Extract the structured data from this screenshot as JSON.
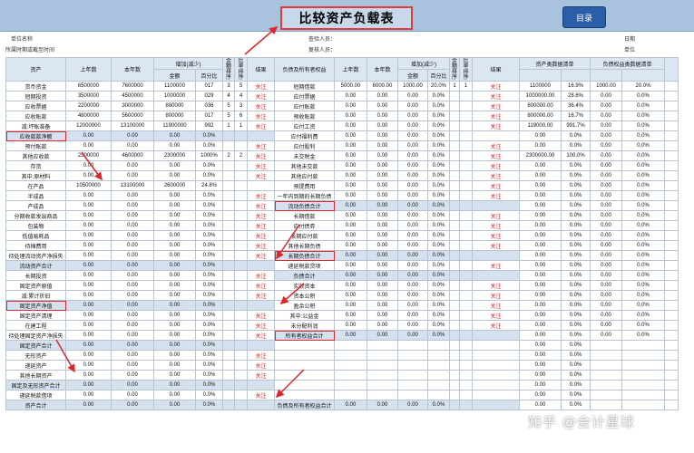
{
  "header": {
    "title": "比较资产负载表",
    "menu_button": "目录"
  },
  "meta": {
    "unit_name": "单位名称",
    "period": "所属时期或截至时间",
    "audit_person": "查验人员：",
    "review_person": "复核人员：",
    "date": "日期",
    "unit": "单位"
  },
  "table": {
    "head_top": {
      "asset": "资产",
      "y_start": "上年数",
      "y_cur": "本年数",
      "change": "增加(减少)",
      "amt_rank": "金额排序",
      "ratio_rank": "比率排序",
      "result": "结果",
      "liab": "负债及所有者权益",
      "l_start": "上年数",
      "l_cur": "本年数",
      "l_change": "增加(减少)",
      "l_amt_rank": "金额排序",
      "l_ratio_rank": "比率排序",
      "l_result": "结果",
      "asset_list": "资产类数据清单",
      "liab_list": "负债权益类数据清单"
    },
    "head_sub": {
      "amount": "金额",
      "pct": "百分比",
      "amount2": "金额",
      "pct2": "百分比"
    },
    "rows": [
      {
        "a": "货币资金",
        "y0": "6500000",
        "y1": "7600000",
        "d": "1100000",
        "p": "017",
        "r1": "3",
        "r2": "5",
        "res": "关注",
        "l": "短期借款",
        "l0": "5000.00",
        "l1": "6000.00",
        "ld": "1000.00",
        "lp": "20.0%",
        "lr1": "1",
        "lr2": "1",
        "lres": "关注",
        "sa": "1100000",
        "sp": "16.9%",
        "sb": "1000.00",
        "sq": "20.0%"
      },
      {
        "a": "短期投资",
        "y0": "3500000",
        "y1": "4500000",
        "d": "1000000",
        "p": "029",
        "r1": "4",
        "r2": "4",
        "res": "关注",
        "l": "应付票据",
        "l0": "0.00",
        "l1": "0.00",
        "ld": "0.00",
        "lp": "0.0%",
        "lr1": "",
        "lr2": "",
        "lres": "关注",
        "sa": "1000000.00",
        "sp": "28.6%",
        "sb": "0.00",
        "sq": "0.0%"
      },
      {
        "a": "应收票据",
        "y0": "2200000",
        "y1": "3000000",
        "d": "800000",
        "p": "036",
        "r1": "5",
        "r2": "3",
        "res": "关注",
        "l": "应付账款",
        "l0": "0.00",
        "l1": "0.00",
        "ld": "0.00",
        "lp": "0.0%",
        "lr1": "",
        "lr2": "",
        "lres": "关注",
        "sa": "800000.00",
        "sp": "36.4%",
        "sb": "0.00",
        "sq": "0.0%"
      },
      {
        "a": "应收账款",
        "y0": "4800000",
        "y1": "5600000",
        "d": "800000",
        "p": "017",
        "r1": "5",
        "r2": "6",
        "res": "关注",
        "l": "预收账款",
        "l0": "0.00",
        "l1": "0.00",
        "ld": "0.00",
        "lp": "0.0%",
        "lr1": "",
        "lr2": "",
        "lres": "关注",
        "sa": "800000.00",
        "sp": "16.7%",
        "sb": "0.00",
        "sq": "0.0%"
      },
      {
        "a": "减:坏账准备",
        "y0": "12000000",
        "y1": "13100000",
        "d": "11900000",
        "p": "992",
        "r1": "1",
        "r2": "1",
        "res": "关注",
        "l": "应付工资",
        "l0": "0.00",
        "l1": "0.00",
        "ld": "0.00",
        "lp": "0.0%",
        "lr1": "",
        "lr2": "",
        "lres": "关注",
        "sa": "119000.00",
        "sp": "991.7%",
        "sb": "0.00",
        "sq": "0.0%"
      },
      {
        "a": "应收款款净额",
        "y0": "0.00",
        "y1": "0.00",
        "d": "0.00",
        "p": "0.0%",
        "r1": "",
        "r2": "",
        "res": "",
        "l": "应付福利费",
        "l0": "0.00",
        "l1": "0.00",
        "ld": "0.00",
        "lp": "0.0%",
        "lr1": "",
        "lr2": "",
        "lres": "",
        "sa": "0.00",
        "sp": "0.0%",
        "sb": "0.00",
        "sq": "0.0%",
        "hl": true,
        "box": true
      },
      {
        "a": "预付账款",
        "y0": "0.00",
        "y1": "0.00",
        "d": "0.00",
        "p": "0.0%",
        "r1": "",
        "r2": "",
        "res": "关注",
        "l": "应付股利",
        "l0": "0.00",
        "l1": "0.00",
        "ld": "0.00",
        "lp": "0.0%",
        "lr1": "",
        "lr2": "",
        "lres": "关注",
        "sa": "0.00",
        "sp": "0.0%",
        "sb": "0.00",
        "sq": "0.0%"
      },
      {
        "a": "其他应收款",
        "y0": "2300000",
        "y1": "4600000",
        "d": "2300000",
        "p": "1000%",
        "r1": "2",
        "r2": "2",
        "res": "关注",
        "l": "未交税金",
        "l0": "0.00",
        "l1": "0.00",
        "ld": "0.00",
        "lp": "0.0%",
        "lr1": "",
        "lr2": "",
        "lres": "关注",
        "sa": "2300000.00",
        "sp": "100.0%",
        "sb": "0.00",
        "sq": "0.0%"
      },
      {
        "a": "存货",
        "y0": "0.00",
        "y1": "0.00",
        "d": "0.00",
        "p": "0.0%",
        "r1": "",
        "r2": "",
        "res": "关注",
        "l": "其他未交款",
        "l0": "0.00",
        "l1": "0.00",
        "ld": "0.00",
        "lp": "0.0%",
        "lr1": "",
        "lr2": "",
        "lres": "关注",
        "sa": "0.00",
        "sp": "0.0%",
        "sb": "0.00",
        "sq": "0.0%"
      },
      {
        "a": "其中:原材料",
        "y0": "0.00",
        "y1": "0.00",
        "d": "0.00",
        "p": "0.0%",
        "r1": "",
        "r2": "",
        "res": "关注",
        "l": "其他应付款",
        "l0": "0.00",
        "l1": "0.00",
        "ld": "0.00",
        "lp": "0.0%",
        "lr1": "",
        "lr2": "",
        "lres": "关注",
        "sa": "0.00",
        "sp": "0.0%",
        "sb": "0.00",
        "sq": "0.0%"
      },
      {
        "a": "在产品",
        "y0": "10500000",
        "y1": "13100000",
        "d": "2600000",
        "p": "24.8%",
        "r1": "",
        "r2": "",
        "res": "",
        "l": "预提费用",
        "l0": "0.00",
        "l1": "0.00",
        "ld": "0.00",
        "lp": "0.0%",
        "lr1": "",
        "lr2": "",
        "lres": "关注",
        "sa": "0.00",
        "sp": "0.0%",
        "sb": "0.00",
        "sq": "0.0%"
      },
      {
        "a": "半成品",
        "y0": "0.00",
        "y1": "0.00",
        "d": "0.00",
        "p": "0.0%",
        "r1": "",
        "r2": "",
        "res": "关注",
        "l": "一年内到期的长期负债",
        "l0": "0.00",
        "l1": "0.00",
        "ld": "0.00",
        "lp": "0.0%",
        "lr1": "",
        "lr2": "",
        "lres": "关注",
        "sa": "0.00",
        "sp": "0.0%",
        "sb": "0.00",
        "sq": "0.0%"
      },
      {
        "a": "产成品",
        "y0": "0.00",
        "y1": "0.00",
        "d": "0.00",
        "p": "0.0%",
        "r1": "",
        "r2": "",
        "res": "关注",
        "l": "流动负债合计",
        "l0": "0.00",
        "l1": "0.00",
        "ld": "0.00",
        "lp": "0.0%",
        "lr1": "",
        "lr2": "",
        "lres": "",
        "sa": "0.00",
        "sp": "0.0%",
        "sb": "0.00",
        "sq": "0.0%",
        "lhl": true,
        "lbox": true
      },
      {
        "a": "分期收款发出商品",
        "y0": "0.00",
        "y1": "0.00",
        "d": "0.00",
        "p": "0.0%",
        "r1": "",
        "r2": "",
        "res": "关注",
        "l": "长期借款",
        "l0": "0.00",
        "l1": "0.00",
        "ld": "0.00",
        "lp": "0.0%",
        "lr1": "",
        "lr2": "",
        "lres": "关注",
        "sa": "0.00",
        "sp": "0.0%",
        "sb": "0.00",
        "sq": "0.0%"
      },
      {
        "a": "包装物",
        "y0": "0.00",
        "y1": "0.00",
        "d": "0.00",
        "p": "0.0%",
        "r1": "",
        "r2": "",
        "res": "关注",
        "l": "应付债券",
        "l0": "0.00",
        "l1": "0.00",
        "ld": "0.00",
        "lp": "0.0%",
        "lr1": "",
        "lr2": "",
        "lres": "关注",
        "sa": "0.00",
        "sp": "0.0%",
        "sb": "0.00",
        "sq": "0.0%"
      },
      {
        "a": "低值易耗品",
        "y0": "0.00",
        "y1": "0.00",
        "d": "0.00",
        "p": "0.0%",
        "r1": "",
        "r2": "",
        "res": "关注",
        "l": "长期应付款",
        "l0": "0.00",
        "l1": "0.00",
        "ld": "0.00",
        "lp": "0.0%",
        "lr1": "",
        "lr2": "",
        "lres": "关注",
        "sa": "0.00",
        "sp": "0.0%",
        "sb": "0.00",
        "sq": "0.0%"
      },
      {
        "a": "待摊费用",
        "y0": "0.00",
        "y1": "0.00",
        "d": "0.00",
        "p": "0.0%",
        "r1": "",
        "r2": "",
        "res": "关注",
        "l": "其他长期负债",
        "l0": "0.00",
        "l1": "0.00",
        "ld": "0.00",
        "lp": "0.0%",
        "lr1": "",
        "lr2": "",
        "lres": "关注",
        "sa": "0.00",
        "sp": "0.0%",
        "sb": "0.00",
        "sq": "0.0%"
      },
      {
        "a": "待处理流动资产净损失",
        "y0": "0.00",
        "y1": "0.00",
        "d": "0.00",
        "p": "0.0%",
        "r1": "",
        "r2": "",
        "res": "关注",
        "l": "长期负债合计",
        "l0": "0.00",
        "l1": "0.00",
        "ld": "0.00",
        "lp": "0.0%",
        "lr1": "",
        "lr2": "",
        "lres": "",
        "sa": "0.00",
        "sp": "0.0%",
        "sb": "0.00",
        "sq": "0.0%",
        "lhl": true,
        "lbox": true
      },
      {
        "a": "流动资产合计",
        "y0": "0.00",
        "y1": "0.00",
        "d": "0.00",
        "p": "0.0%",
        "r1": "",
        "r2": "",
        "res": "",
        "l": "递延税款贷项",
        "l0": "0.00",
        "l1": "0.00",
        "ld": "0.00",
        "lp": "0.0%",
        "lr1": "",
        "lr2": "",
        "lres": "关注",
        "sa": "0.00",
        "sp": "0.0%",
        "sb": "0.00",
        "sq": "0.0%",
        "hl": true
      },
      {
        "a": "长期投资",
        "y0": "0.00",
        "y1": "0.00",
        "d": "0.00",
        "p": "0.0%",
        "r1": "",
        "r2": "",
        "res": "关注",
        "l": "负债合计",
        "l0": "0.00",
        "l1": "0.00",
        "ld": "0.00",
        "lp": "0.0%",
        "lr1": "",
        "lr2": "",
        "lres": "",
        "sa": "0.00",
        "sp": "0.0%",
        "sb": "0.00",
        "sq": "0.0%",
        "lhl": true
      },
      {
        "a": "固定资产原值",
        "y0": "0.00",
        "y1": "0.00",
        "d": "0.00",
        "p": "0.0%",
        "r1": "",
        "r2": "",
        "res": "关注",
        "l": "实收资本",
        "l0": "0.00",
        "l1": "0.00",
        "ld": "0.00",
        "lp": "0.0%",
        "lr1": "",
        "lr2": "",
        "lres": "关注",
        "sa": "0.00",
        "sp": "0.0%",
        "sb": "0.00",
        "sq": "0.0%"
      },
      {
        "a": "减:累计折旧",
        "y0": "0.00",
        "y1": "0.00",
        "d": "0.00",
        "p": "0.0%",
        "r1": "",
        "r2": "",
        "res": "关注",
        "l": "资本公积",
        "l0": "0.00",
        "l1": "0.00",
        "ld": "0.00",
        "lp": "0.0%",
        "lr1": "",
        "lr2": "",
        "lres": "关注",
        "sa": "0.00",
        "sp": "0.0%",
        "sb": "0.00",
        "sq": "0.0%"
      },
      {
        "a": "固定资产净值",
        "y0": "0.00",
        "y1": "0.00",
        "d": "0.00",
        "p": "0.0%",
        "r1": "",
        "r2": "",
        "res": "",
        "l": "盈余公积",
        "l0": "0.00",
        "l1": "0.00",
        "ld": "0.00",
        "lp": "0.0%",
        "lr1": "",
        "lr2": "",
        "lres": "关注",
        "sa": "0.00",
        "sp": "0.0%",
        "sb": "0.00",
        "sq": "0.0%",
        "hl": true,
        "box": true
      },
      {
        "a": "固定资产清理",
        "y0": "0.00",
        "y1": "0.00",
        "d": "0.00",
        "p": "0.0%",
        "r1": "",
        "r2": "",
        "res": "关注",
        "l": "其中:公益金",
        "l0": "0.00",
        "l1": "0.00",
        "ld": "0.00",
        "lp": "0.0%",
        "lr1": "",
        "lr2": "",
        "lres": "关注",
        "sa": "0.00",
        "sp": "0.0%",
        "sb": "0.00",
        "sq": "0.0%"
      },
      {
        "a": "在建工程",
        "y0": "0.00",
        "y1": "0.00",
        "d": "0.00",
        "p": "0.0%",
        "r1": "",
        "r2": "",
        "res": "关注",
        "l": "未分配利润",
        "l0": "0.00",
        "l1": "0.00",
        "ld": "0.00",
        "lp": "0.0%",
        "lr1": "",
        "lr2": "",
        "lres": "关注",
        "sa": "0.00",
        "sp": "0.0%",
        "sb": "0.00",
        "sq": "0.0%"
      },
      {
        "a": "待处理固定资产净损失",
        "y0": "0.00",
        "y1": "0.00",
        "d": "0.00",
        "p": "0.0%",
        "r1": "",
        "r2": "",
        "res": "关注",
        "l": "所有者权益合计",
        "l0": "0.00",
        "l1": "0.00",
        "ld": "0.00",
        "lp": "0.0%",
        "lr1": "",
        "lr2": "",
        "lres": "",
        "sa": "0.00",
        "sp": "0.0%",
        "sb": "0.00",
        "sq": "0.0%",
        "lhl": true,
        "lbox": true
      },
      {
        "a": "固定资产合计",
        "y0": "0.00",
        "y1": "0.00",
        "d": "0.00",
        "p": "0.0%",
        "r1": "",
        "r2": "",
        "res": "",
        "l": "",
        "l0": "",
        "l1": "",
        "ld": "",
        "lp": "",
        "lr1": "",
        "lr2": "",
        "lres": "",
        "sa": "0.00",
        "sp": "0.0%",
        "sb": "",
        "sq": "",
        "hl": true
      },
      {
        "a": "无形资产",
        "y0": "0.00",
        "y1": "0.00",
        "d": "0.00",
        "p": "0.0%",
        "r1": "",
        "r2": "",
        "res": "关注",
        "l": "",
        "l0": "",
        "l1": "",
        "ld": "",
        "lp": "",
        "lr1": "",
        "lr2": "",
        "lres": "",
        "sa": "0.00",
        "sp": "0.0%",
        "sb": "",
        "sq": ""
      },
      {
        "a": "递延资产",
        "y0": "0.00",
        "y1": "0.00",
        "d": "0.00",
        "p": "0.0%",
        "r1": "",
        "r2": "",
        "res": "关注",
        "l": "",
        "l0": "",
        "l1": "",
        "ld": "",
        "lp": "",
        "lr1": "",
        "lr2": "",
        "lres": "",
        "sa": "0.00",
        "sp": "0.0%",
        "sb": "",
        "sq": ""
      },
      {
        "a": "其他长期资产",
        "y0": "0.00",
        "y1": "0.00",
        "d": "0.00",
        "p": "0.0%",
        "r1": "",
        "r2": "",
        "res": "关注",
        "l": "",
        "l0": "",
        "l1": "",
        "ld": "",
        "lp": "",
        "lr1": "",
        "lr2": "",
        "lres": "",
        "sa": "0.00",
        "sp": "0.0%",
        "sb": "",
        "sq": ""
      },
      {
        "a": "固定及无形资产合计",
        "y0": "0.00",
        "y1": "0.00",
        "d": "0.00",
        "p": "0.0%",
        "r1": "",
        "r2": "",
        "res": "",
        "l": "",
        "l0": "",
        "l1": "",
        "ld": "",
        "lp": "",
        "lr1": "",
        "lr2": "",
        "lres": "",
        "sa": "0.00",
        "sp": "0.0%",
        "sb": "",
        "sq": "",
        "hl": true
      },
      {
        "a": "递延税款借项",
        "y0": "0.00",
        "y1": "0.00",
        "d": "0.00",
        "p": "0.0%",
        "r1": "",
        "r2": "",
        "res": "关注",
        "l": "",
        "l0": "",
        "l1": "",
        "ld": "",
        "lp": "",
        "lr1": "",
        "lr2": "",
        "lres": "",
        "sa": "0.00",
        "sp": "0.0%",
        "sb": "",
        "sq": ""
      },
      {
        "a": "资产合计",
        "y0": "0.00",
        "y1": "0.00",
        "d": "0.00",
        "p": "0.0%",
        "r1": "",
        "r2": "",
        "res": "",
        "l": "负债及所有者权益合计",
        "l0": "0.00",
        "l1": "0.00",
        "ld": "0.00",
        "lp": "0.0%",
        "lr1": "",
        "lr2": "",
        "lres": "",
        "sa": "0.00",
        "sp": "0.0%",
        "sb": "",
        "sq": "",
        "hl": true,
        "lhl": true
      }
    ]
  },
  "watermark": "知乎 @会计星球",
  "colors": {
    "header_bg": "#a9c2dd",
    "title_border": "#e03a3a",
    "button_bg": "#2a5ea8",
    "highlight_row": "#d5e1ef",
    "attention_text": "#e0262a"
  }
}
